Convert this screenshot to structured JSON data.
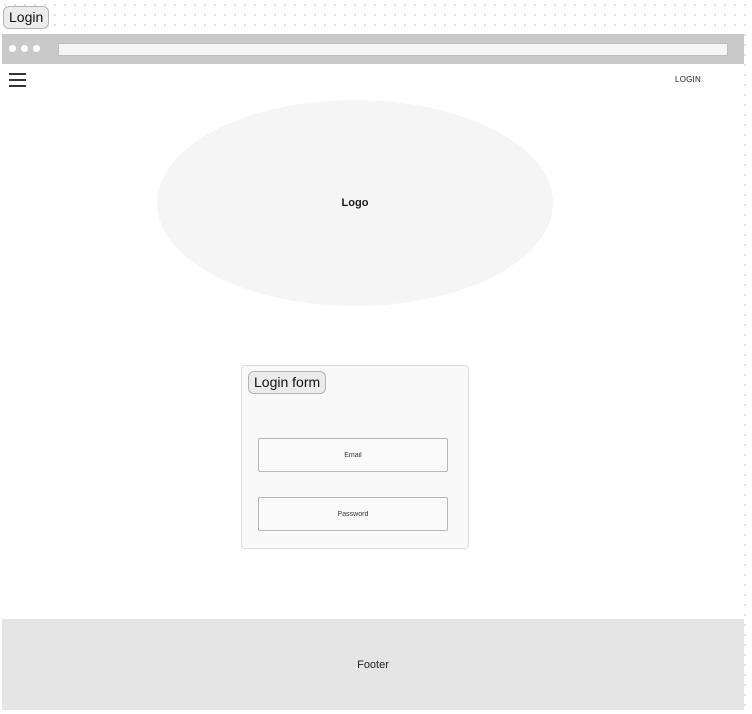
{
  "frame": {
    "label": "Login"
  },
  "browser": {
    "icons": {
      "window_controls": "traffic-light-dots",
      "menu": "hamburger-menu-icon"
    }
  },
  "nav": {
    "login_label": "LOGIN"
  },
  "logo": {
    "label": "Logo"
  },
  "login_form": {
    "title": "Login form",
    "email": {
      "placeholder": "Email",
      "value": ""
    },
    "password": {
      "placeholder": "Password",
      "value": ""
    }
  },
  "footer": {
    "label": "Footer"
  },
  "colors": {
    "chrome": "#c9c9c9",
    "logo_fill": "#f5f5f5",
    "form_fill": "#f9f9f9",
    "footer_fill": "#e5e5e5"
  }
}
